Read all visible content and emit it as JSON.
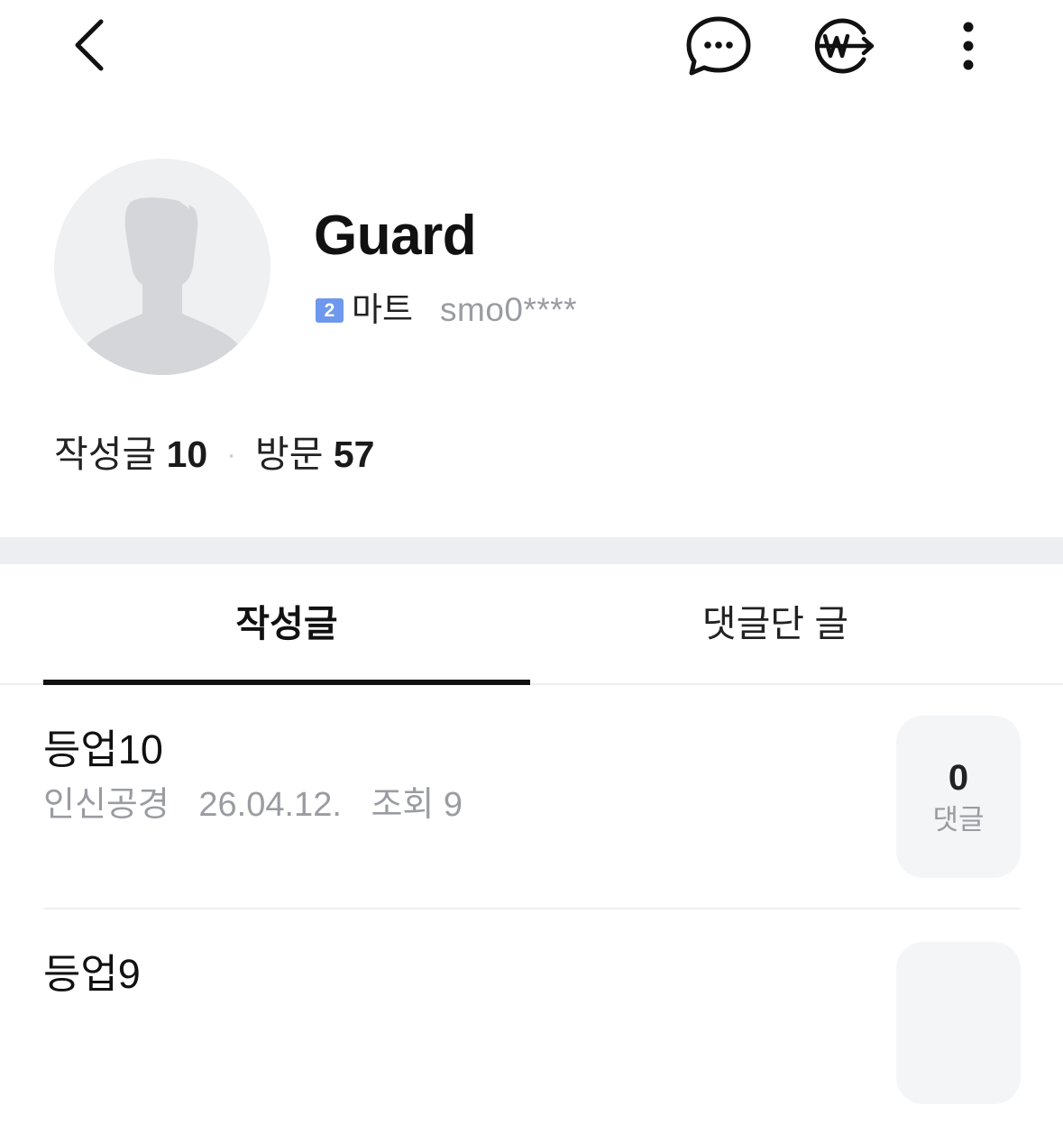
{
  "header": {
    "back_icon": "chevron-left-icon",
    "chat_icon": "chat-bubble-ellipsis-icon",
    "won_icon": "won-transfer-icon",
    "more_icon": "vertical-ellipsis-icon"
  },
  "profile": {
    "nickname": "Guard",
    "level_number": "2",
    "level_name": "마트",
    "user_id": "smo0****",
    "badge_color": "#6d98ee"
  },
  "stats": {
    "posts_label": "작성글",
    "posts_count": "10",
    "separator": "·",
    "visits_label": "방문",
    "visits_count": "57"
  },
  "tabs": [
    {
      "label": "작성글",
      "active": true
    },
    {
      "label": "댓글단 글",
      "active": false
    }
  ],
  "posts": [
    {
      "title": "등업10",
      "board": "인신공경",
      "date": "26.04.12.",
      "views_label": "조회 9",
      "comment_count": "0",
      "comment_label": "댓글"
    },
    {
      "title": "등업9"
    }
  ]
}
